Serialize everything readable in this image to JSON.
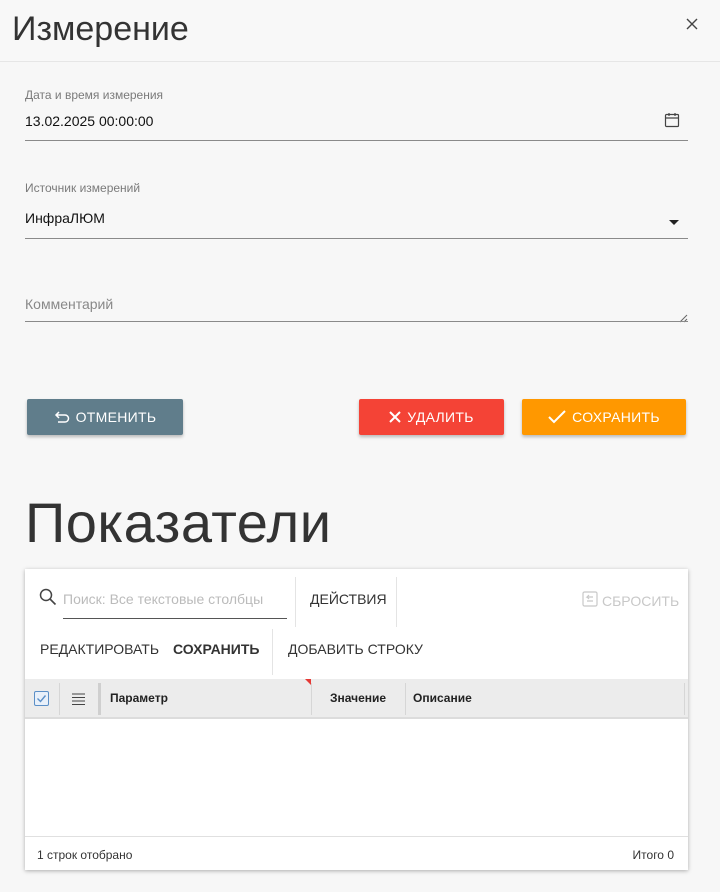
{
  "dialog": {
    "title": "Измерение"
  },
  "form": {
    "date": {
      "label": "Дата и время измерения",
      "value": "13.02.2025 00:00:00"
    },
    "source": {
      "label": "Источник измерений",
      "value": "ИнфраЛЮМ"
    },
    "comment": {
      "placeholder": "Комментарий",
      "value": ""
    }
  },
  "actions": {
    "cancel": "ОТМЕНИТЬ",
    "delete": "УДАЛИТЬ",
    "save": "СОХРАНИТЬ"
  },
  "section": {
    "title": "Показатели"
  },
  "grid": {
    "search_placeholder": "Поиск: Все текстовые столбцы",
    "toolbar": {
      "actions": "ДЕЙСТВИЯ",
      "reset": "СБРОСИТЬ",
      "edit": "РЕДАКТИРОВАТЬ",
      "save": "СОХРАНИТЬ",
      "add_row": "ДОБАВИТЬ СТРОКУ"
    },
    "columns": [
      "Параметр",
      "Значение",
      "Описание"
    ],
    "rows": [],
    "footer": {
      "shown": "1 строк отобрано",
      "total": "Итого 0"
    }
  },
  "colors": {
    "cancel": "#607d8b",
    "delete": "#f44336",
    "save": "#ff9800"
  },
  "icons": [
    "close-icon",
    "calendar-icon",
    "dropdown-arrow-icon",
    "resize-handle-icon",
    "undo-icon",
    "x-icon",
    "check-icon",
    "search-icon",
    "reset-icon",
    "checkbox-icon",
    "column-menu-icon"
  ]
}
